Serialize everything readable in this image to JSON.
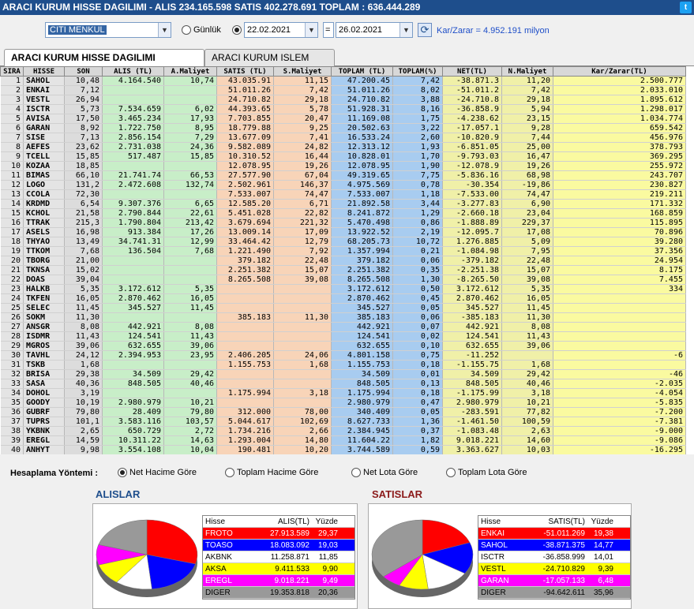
{
  "titlebar": {
    "title": "ARACI KURUM HISSE DAGILIMI - ALIS 234.165.598  SATIS 402.278.691  TOPLAM : 636.444.289"
  },
  "toolbar": {
    "broker_value": "CITI MENKUL",
    "option_daily": "Günlük",
    "date_from": "22.02.2021",
    "equals": "=",
    "date_to": "26.02.2021",
    "pnl_text": "Kar/Zarar = 4.952.191 milyon"
  },
  "tabs": [
    {
      "label": "ARACI KURUM HISSE DAGILIMI"
    },
    {
      "label": "ARACI KURUM ISLEM OZETI"
    }
  ],
  "grid": {
    "headers": [
      "SIRA",
      "HISSE",
      "SON",
      "ALIS (TL)",
      "A.Maliyet",
      "SATIS (TL)",
      "S.Maliyet",
      "TOPLAM (TL)",
      "TOPLAM(%)",
      "NET(TL)",
      "N.Maliyet",
      "Kar/Zarar(TL)"
    ],
    "rows": [
      [
        "1",
        "SAHOL",
        "10,48",
        "4.164.540",
        "10,74",
        "43.035.91",
        "11,15",
        "47.200.45",
        "7,42",
        "-38.871.3",
        "11,20",
        "2.500.777"
      ],
      [
        "2",
        "ENKAI",
        "7,12",
        "",
        "",
        "51.011.26",
        "7,42",
        "51.011.26",
        "8,02",
        "-51.011.2",
        "7,42",
        "2.033.010"
      ],
      [
        "3",
        "VESTL",
        "26,94",
        "",
        "",
        "24.710.82",
        "29,18",
        "24.710.82",
        "3,88",
        "-24.710.8",
        "29,18",
        "1.895.612"
      ],
      [
        "4",
        "ISCTR",
        "5,73",
        "7.534.659",
        "6,02",
        "44.393.65",
        "5,78",
        "51.928.31",
        "8,16",
        "-36.858.9",
        "5,94",
        "1.298.017"
      ],
      [
        "5",
        "AVISA",
        "17,50",
        "3.465.234",
        "17,93",
        "7.703.855",
        "20,47",
        "11.169.08",
        "1,75",
        "-4.238.62",
        "23,15",
        "1.034.774"
      ],
      [
        "6",
        "GARAN",
        "8,92",
        "1.722.750",
        "8,95",
        "18.779.88",
        "9,25",
        "20.502.63",
        "3,22",
        "-17.057.1",
        "9,28",
        "659.542"
      ],
      [
        "7",
        "SISE",
        "7,13",
        "2.856.154",
        "7,29",
        "13.677.09",
        "7,41",
        "16.533.24",
        "2,60",
        "-10.820.9",
        "7,44",
        "456.976"
      ],
      [
        "8",
        "AEFES",
        "23,62",
        "2.731.038",
        "24,36",
        "9.582.089",
        "24,82",
        "12.313.12",
        "1,93",
        "-6.851.05",
        "25,00",
        "378.793"
      ],
      [
        "9",
        "TCELL",
        "15,85",
        "517.487",
        "15,85",
        "10.310.52",
        "16,44",
        "10.828.01",
        "1,70",
        "-9.793.03",
        "16,47",
        "369.295"
      ],
      [
        "10",
        "KOZAA",
        "18,85",
        "",
        "",
        "12.078.95",
        "19,26",
        "12.078.95",
        "1,90",
        "-12.078.9",
        "19,26",
        "255.972"
      ],
      [
        "11",
        "BIMAS",
        "66,10",
        "21.741.74",
        "66,53",
        "27.577.90",
        "67,04",
        "49.319.65",
        "7,75",
        "-5.836.16",
        "68,98",
        "243.707"
      ],
      [
        "12",
        "LOGO",
        "131,2",
        "2.472.608",
        "132,74",
        "2.502.961",
        "146,37",
        "4.975.569",
        "0,78",
        "-30.354",
        "-19,86",
        "230.827"
      ],
      [
        "13",
        "CCOLA",
        "72,30",
        "",
        "",
        "7.533.007",
        "74,47",
        "7.533.007",
        "1,18",
        "-7.533.00",
        "74,47",
        "219.211"
      ],
      [
        "14",
        "KRDMD",
        "6,54",
        "9.307.376",
        "6,65",
        "12.585.20",
        "6,71",
        "21.892.58",
        "3,44",
        "-3.277.83",
        "6,90",
        "171.332"
      ],
      [
        "15",
        "KCHOL",
        "21,58",
        "2.790.844",
        "22,61",
        "5.451.028",
        "22,82",
        "8.241.872",
        "1,29",
        "-2.660.18",
        "23,04",
        "168.859"
      ],
      [
        "16",
        "TTRAK",
        "215,3",
        "1.790.804",
        "213,42",
        "3.679.694",
        "221,32",
        "5.470.498",
        "0,86",
        "-1.888.89",
        "229,37",
        "115.895"
      ],
      [
        "17",
        "ASELS",
        "16,98",
        "913.384",
        "17,26",
        "13.009.14",
        "17,09",
        "13.922.52",
        "2,19",
        "-12.095.7",
        "17,08",
        "70.896"
      ],
      [
        "18",
        "THYAO",
        "13,49",
        "34.741.31",
        "12,99",
        "33.464.42",
        "12,79",
        "68.205.73",
        "10,72",
        "1.276.885",
        "5,09",
        "39.280"
      ],
      [
        "19",
        "TTKOM",
        "7,68",
        "136.504",
        "7,68",
        "1.221.490",
        "7,92",
        "1.357.994",
        "0,21",
        "-1.084.98",
        "7,95",
        "37.356"
      ],
      [
        "20",
        "TBORG",
        "21,00",
        "",
        "",
        "379.182",
        "22,48",
        "379.182",
        "0,06",
        "-379.182",
        "22,48",
        "24.954"
      ],
      [
        "21",
        "TKNSA",
        "15,02",
        "",
        "",
        "2.251.382",
        "15,07",
        "2.251.382",
        "0,35",
        "-2.251.38",
        "15,07",
        "8.175"
      ],
      [
        "22",
        "DOAS",
        "39,04",
        "",
        "",
        "8.265.508",
        "39,08",
        "8.265.508",
        "1,30",
        "-8.265.50",
        "39,08",
        "7.455"
      ],
      [
        "23",
        "HALKB",
        "5,35",
        "3.172.612",
        "5,35",
        "",
        "",
        "3.172.612",
        "0,50",
        "3.172.612",
        "5,35",
        "334"
      ],
      [
        "24",
        "TKFEN",
        "16,05",
        "2.870.462",
        "16,05",
        "",
        "",
        "2.870.462",
        "0,45",
        "2.870.462",
        "16,05",
        ""
      ],
      [
        "25",
        "SELEC",
        "11,45",
        "345.527",
        "11,45",
        "",
        "",
        "345.527",
        "0,05",
        "345.527",
        "11,45",
        ""
      ],
      [
        "26",
        "SOKM",
        "11,30",
        "",
        "",
        "385.183",
        "11,30",
        "385.183",
        "0,06",
        "-385.183",
        "11,30",
        ""
      ],
      [
        "27",
        "ANSGR",
        "8,08",
        "442.921",
        "8,08",
        "",
        "",
        "442.921",
        "0,07",
        "442.921",
        "8,08",
        ""
      ],
      [
        "28",
        "ISDMR",
        "11,43",
        "124.541",
        "11,43",
        "",
        "",
        "124.541",
        "0,02",
        "124.541",
        "11,43",
        ""
      ],
      [
        "29",
        "MGROS",
        "39,06",
        "632.655",
        "39,06",
        "",
        "",
        "632.655",
        "0,10",
        "632.655",
        "39,06",
        ""
      ],
      [
        "30",
        "TAVHL",
        "24,12",
        "2.394.953",
        "23,95",
        "2.406.205",
        "24,06",
        "4.801.158",
        "0,75",
        "-11.252",
        "",
        "-6"
      ],
      [
        "31",
        "TSKB",
        "1,68",
        "",
        "",
        "1.155.753",
        "1,68",
        "1.155.753",
        "0,18",
        "-1.155.75",
        "1,68",
        ""
      ],
      [
        "32",
        "BRISA",
        "29,38",
        "34.509",
        "29,42",
        "",
        "",
        "34.509",
        "0,01",
        "34.509",
        "29,42",
        "-46"
      ],
      [
        "33",
        "SASA",
        "40,36",
        "848.505",
        "40,46",
        "",
        "",
        "848.505",
        "0,13",
        "848.505",
        "40,46",
        "-2.035"
      ],
      [
        "34",
        "DOHOL",
        "3,19",
        "",
        "",
        "1.175.994",
        "3,18",
        "1.175.994",
        "0,18",
        "-1.175.99",
        "3,18",
        "-4.054"
      ],
      [
        "35",
        "GOODY",
        "10,19",
        "2.980.979",
        "10,21",
        "",
        "",
        "2.980.979",
        "0,47",
        "2.980.979",
        "10,21",
        "-5.835"
      ],
      [
        "36",
        "GUBRF",
        "79,80",
        "28.409",
        "79,80",
        "312.000",
        "78,00",
        "340.409",
        "0,05",
        "-283.591",
        "77,82",
        "-7.200"
      ],
      [
        "37",
        "TUPRS",
        "101,1",
        "3.583.116",
        "103,57",
        "5.044.617",
        "102,69",
        "8.627.733",
        "1,36",
        "-1.461.50",
        "100,59",
        "-7.381"
      ],
      [
        "38",
        "YKBNK",
        "2,65",
        "650.729",
        "2,72",
        "1.734.216",
        "2,66",
        "2.384.945",
        "0,37",
        "-1.083.48",
        "2,63",
        "-9.000"
      ],
      [
        "39",
        "EREGL",
        "14,59",
        "10.311.22",
        "14,63",
        "1.293.004",
        "14,80",
        "11.604.22",
        "1,82",
        "9.018.221",
        "14,60",
        "-9.086"
      ],
      [
        "40",
        "ANHYT",
        "9,98",
        "3.554.108",
        "10,04",
        "190.481",
        "10,20",
        "3.744.589",
        "0,59",
        "3.363.627",
        "10,03",
        "-16.295"
      ]
    ]
  },
  "method": {
    "label": "Hesaplama Yöntemi :",
    "options": [
      "Net Hacime Göre",
      "Toplam Hacime Göre",
      "Net Lota Göre",
      "Toplam Lota Göre"
    ]
  },
  "alislar": {
    "title": "ALISLAR",
    "headers": [
      "Hisse",
      "ALIS(TL)",
      "Yüzde"
    ],
    "rows": [
      {
        "name": "FROTO",
        "value": "27.913.589",
        "pct": "29,37",
        "color": "#ff0000",
        "fg": "#ffffff"
      },
      {
        "name": "TOASO",
        "value": "18.083.092",
        "pct": "19,03",
        "color": "#0000ff",
        "fg": "#ffffff"
      },
      {
        "name": "AKBNK",
        "value": "11.258.871",
        "pct": "11,85",
        "color": "#ffffff",
        "fg": "#000000"
      },
      {
        "name": "AKSA",
        "value": "9.411.533",
        "pct": "9,90",
        "color": "#ffff00",
        "fg": "#000000"
      },
      {
        "name": "EREGL",
        "value": "9.018.221",
        "pct": "9,49",
        "color": "#ff00ff",
        "fg": "#ffffff"
      },
      {
        "name": "DIGER",
        "value": "19.353.818",
        "pct": "20,36",
        "color": "#999999",
        "fg": "#000000"
      }
    ],
    "slices": [
      29.37,
      19.03,
      11.85,
      9.9,
      9.49,
      20.36
    ]
  },
  "satislar": {
    "title": "SATISLAR",
    "headers": [
      "Hisse",
      "SATIS(TL)",
      "Yüzde"
    ],
    "rows": [
      {
        "name": "ENKAI",
        "value": "-51.011.269",
        "pct": "19,38",
        "color": "#ff0000",
        "fg": "#ffffff"
      },
      {
        "name": "SAHOL",
        "value": "-38.871.375",
        "pct": "14,77",
        "color": "#0000ff",
        "fg": "#ffffff"
      },
      {
        "name": "ISCTR",
        "value": "-36.858.999",
        "pct": "14,01",
        "color": "#ffffff",
        "fg": "#000000"
      },
      {
        "name": "VESTL",
        "value": "-24.710.829",
        "pct": "9,39",
        "color": "#ffff00",
        "fg": "#000000"
      },
      {
        "name": "GARAN",
        "value": "-17.057.133",
        "pct": "6,48",
        "color": "#ff00ff",
        "fg": "#ffffff"
      },
      {
        "name": "DIGER",
        "value": "-94.642.611",
        "pct": "35,96",
        "color": "#999999",
        "fg": "#000000"
      }
    ],
    "slices": [
      19.38,
      14.77,
      14.01,
      9.39,
      6.48,
      35.96
    ]
  }
}
